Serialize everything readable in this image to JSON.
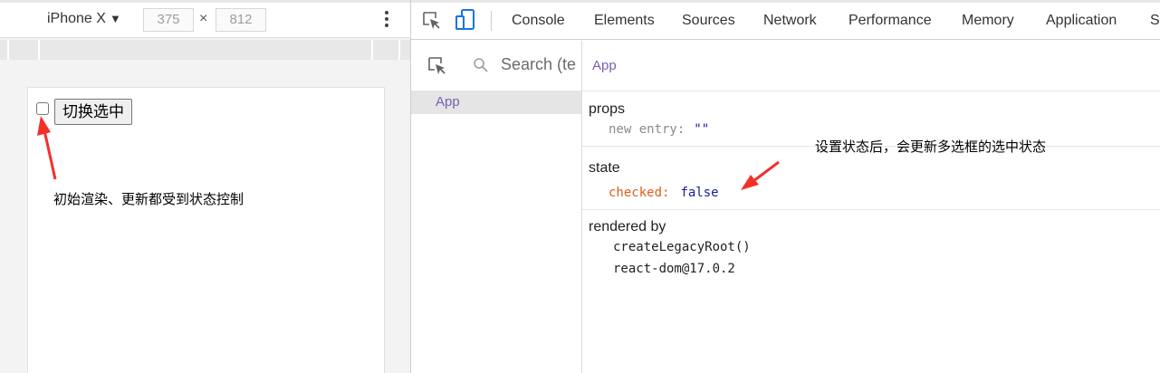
{
  "device_toolbar": {
    "device_name": "iPhone X",
    "width_value": "375",
    "height_value": "812",
    "times": "×"
  },
  "page": {
    "toggle_button_label": "切换选中",
    "checkbox_checked": false,
    "annotation": "初始渲染、更新都受到状态控制"
  },
  "devtools": {
    "tabs": [
      "Console",
      "Elements",
      "Sources",
      "Network",
      "Performance",
      "Memory",
      "Application",
      "Se"
    ],
    "tree": {
      "search_placeholder": "Search (te",
      "selected_component": "App"
    },
    "inspector": {
      "component_name": "App",
      "props_heading": "props",
      "props": [
        {
          "key": "new entry:",
          "value": "\"\""
        }
      ],
      "state_heading": "state",
      "state": [
        {
          "key": "checked:",
          "value": "false"
        }
      ],
      "rendered_by_heading": "rendered by",
      "rendered_by": [
        "createLegacyRoot()",
        "react-dom@17.0.2"
      ]
    },
    "annotation": "设置状态后，会更新多选框的选中状态"
  },
  "colors": {
    "accent_blue": "#1a73e8",
    "component_purple": "#7b5fb7",
    "state_key_orange": "#e05d1a",
    "annotation_arrow_red": "#f2312a"
  }
}
